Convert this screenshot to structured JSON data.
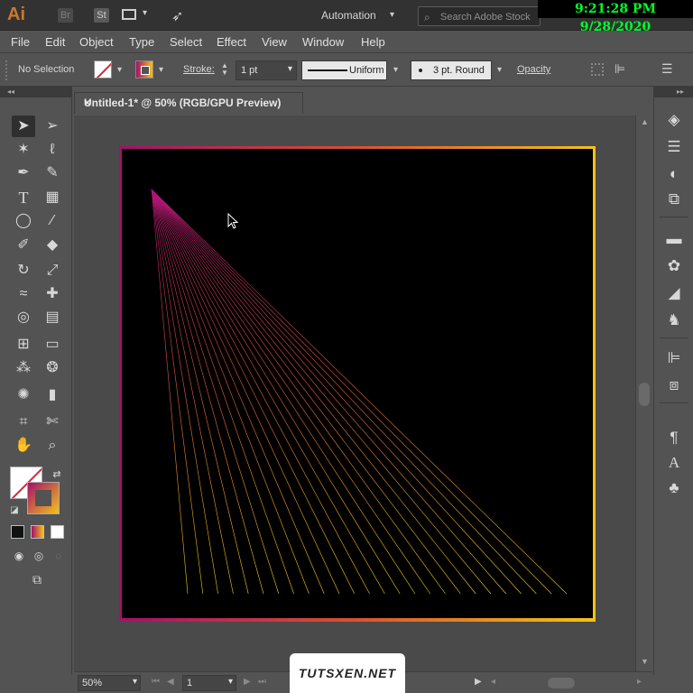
{
  "app": {
    "logo": "Ai",
    "bridge_label": "Br",
    "stock_label": "St",
    "workspace": "Automation",
    "search_placeholder": "Search Adobe Stock",
    "clock": "9:21:28 PM 9/28/2020"
  },
  "menu": [
    "File",
    "Edit",
    "Object",
    "Type",
    "Select",
    "Effect",
    "View",
    "Window",
    "Help"
  ],
  "control": {
    "selection_status": "No Selection",
    "stroke_label": "Stroke:",
    "stroke_weight": "1 pt",
    "variable_width": "Uniform",
    "brush": "3 pt. Round",
    "opacity_label": "Opacity"
  },
  "document": {
    "tab_title": "Untitled-1* @ 50% (RGB/GPU Preview)",
    "close_glyph": "×"
  },
  "status": {
    "zoom": "50%",
    "artboard": "1"
  },
  "watermark": "TUTSXEN.NET",
  "colors": {
    "gradient_start": "#a4106b",
    "gradient_end": "#f3c21a",
    "clock_text": "#00ff2a"
  },
  "icons": {
    "tools": [
      "selection-icon",
      "direct-selection-icon",
      "magic-wand-icon",
      "lasso-icon",
      "pen-icon",
      "curvature-icon",
      "type-icon",
      "grid-icon",
      "ellipse-icon",
      "paintbrush-icon",
      "shaper-icon",
      "eraser-icon",
      "rotate-icon",
      "scale-icon",
      "width-icon",
      "puppet-warp-icon",
      "shape-builder-icon",
      "perspective-grid-icon",
      "mesh-icon",
      "gradient-icon",
      "eyedropper-icon",
      "blend-icon",
      "symbol-sprayer-icon",
      "column-graph-icon",
      "artboard-icon",
      "slice-icon",
      "hand-icon",
      "zoom-icon"
    ],
    "right_panel": [
      "layers-icon",
      "properties-icon",
      "appearance-icon",
      "transform-icon",
      "swatches-icon",
      "color-icon",
      "brushes-icon",
      "symbols-icon",
      "align-icon",
      "pathfinder-icon",
      "paragraph-icon",
      "character-icon",
      "glyphs-icon"
    ]
  }
}
